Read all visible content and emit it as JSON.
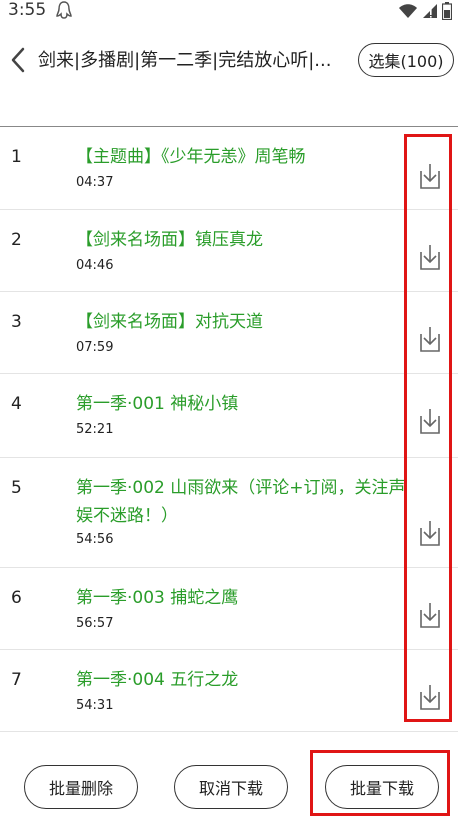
{
  "status": {
    "time": "3:55"
  },
  "header": {
    "title": "剑来|多播剧|第一二季|完结放心听|...",
    "select_label": "选集(100)"
  },
  "episodes": [
    {
      "num": "1",
      "title": "【主题曲】《少年无恙》周笔畅",
      "duration": "04:37"
    },
    {
      "num": "2",
      "title": "【剑来名场面】镇压真龙",
      "duration": "04:46"
    },
    {
      "num": "3",
      "title": "【剑来名场面】对抗天道",
      "duration": "07:59"
    },
    {
      "num": "4",
      "title": "第一季·001 神秘小镇",
      "duration": "52:21"
    },
    {
      "num": "5",
      "title": "第一季·002 山雨欲来（评论+订阅，关注声娱不迷路！）",
      "duration": "54:56"
    },
    {
      "num": "6",
      "title": "第一季·003 捕蛇之鹰",
      "duration": "56:57"
    },
    {
      "num": "7",
      "title": "第一季·004 五行之龙",
      "duration": "54:31"
    }
  ],
  "footer": {
    "delete_label": "批量删除",
    "cancel_label": "取消下载",
    "batch_label": "批量下载"
  },
  "colors": {
    "title_green": "#2a9d2a",
    "highlight_red": "#e01515"
  }
}
